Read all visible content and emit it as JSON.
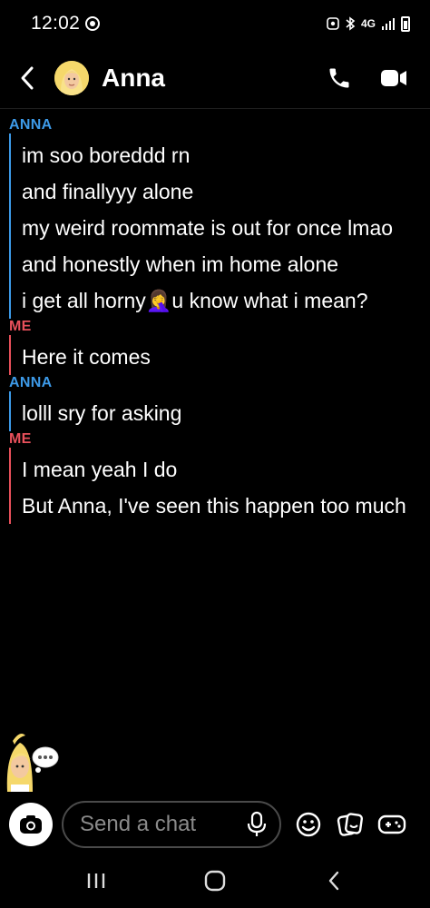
{
  "status_bar": {
    "time": "12:02",
    "network": "4G",
    "icons": [
      "alarm-icon",
      "bluetooth-icon",
      "network-4g-icon",
      "signal-icon",
      "battery-icon"
    ]
  },
  "header": {
    "contact_name": "Anna",
    "icons": [
      "back-icon",
      "avatar",
      "phone-icon",
      "video-icon"
    ]
  },
  "conversation": [
    {
      "sender": "ANNA",
      "messages": [
        "im soo boreddd rn",
        "and finallyyy alone",
        "my weird roommate is out for once lmao",
        "and honestly when im home alone",
        "i get all horny🤦‍♀️u know what i mean?"
      ]
    },
    {
      "sender": "ME",
      "messages": [
        "Here it comes"
      ]
    },
    {
      "sender": "ANNA",
      "messages": [
        "lolll sry for asking"
      ]
    },
    {
      "sender": "ME",
      "messages": [
        "I mean yeah I do",
        "But Anna, I've seen this happen too much"
      ]
    }
  ],
  "composer": {
    "placeholder": "Send a chat",
    "icons": [
      "camera-icon",
      "mic-icon",
      "emoji-icon",
      "sticker-icon",
      "game-icon"
    ]
  },
  "colors": {
    "anna": "#3d9ae8",
    "me": "#e8505b",
    "background": "#000000"
  }
}
